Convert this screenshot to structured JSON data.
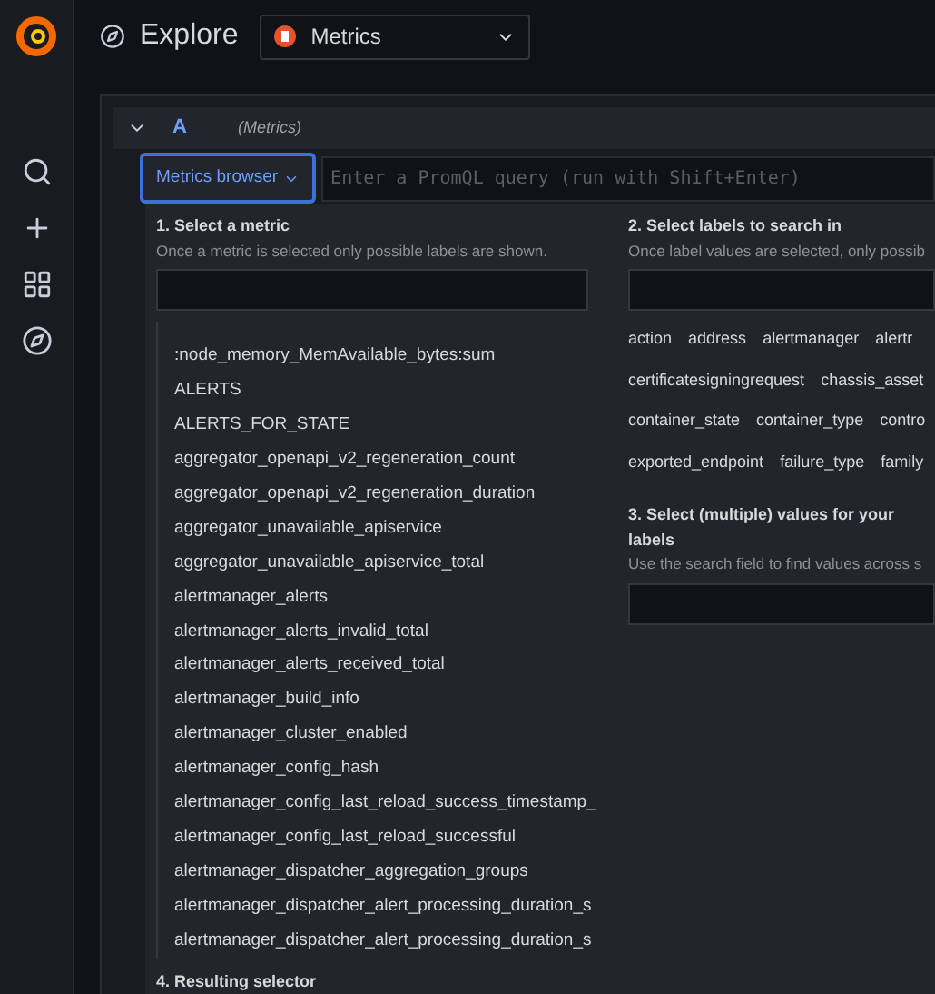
{
  "header": {
    "title": "Explore",
    "datasource": "Metrics"
  },
  "query_row": {
    "letter": "A",
    "source": "(Metrics)",
    "expanded": true,
    "browser_button": "Metrics browser",
    "browser_open": true,
    "placeholder": "Enter a PromQL query (run with Shift+Enter)"
  },
  "metric_step": {
    "title": "1. Select a metric",
    "hint": "Once a metric is selected only possible labels are shown.",
    "metrics": [
      ":node_memory_MemAvailable_bytes:sum",
      "ALERTS",
      "ALERTS_FOR_STATE",
      "aggregator_openapi_v2_regeneration_count",
      "aggregator_openapi_v2_regeneration_duration",
      "aggregator_unavailable_apiservice",
      "aggregator_unavailable_apiservice_total",
      "alertmanager_alerts",
      "alertmanager_alerts_invalid_total",
      "alertmanager_alerts_received_total",
      "alertmanager_build_info",
      "alertmanager_cluster_enabled",
      "alertmanager_config_hash",
      "alertmanager_config_last_reload_success_timestamp_",
      "alertmanager_config_last_reload_successful",
      "alertmanager_dispatcher_aggregation_groups",
      "alertmanager_dispatcher_alert_processing_duration_s",
      "alertmanager_dispatcher_alert_processing_duration_s"
    ]
  },
  "label_step": {
    "title": "2. Select labels to search in",
    "hint": "Once label values are selected, only possib",
    "labels": [
      "action",
      "address",
      "alertmanager",
      "alertr",
      "certificatesigningrequest",
      "chassis_asset",
      "container_state",
      "container_type",
      "contro",
      "exported_endpoint",
      "failure_type",
      "family"
    ]
  },
  "value_step": {
    "title": "3. Select (multiple) values for your labels",
    "hint": "Use the search field to find values across s"
  },
  "selector_step": {
    "title": "4. Resulting selector"
  }
}
